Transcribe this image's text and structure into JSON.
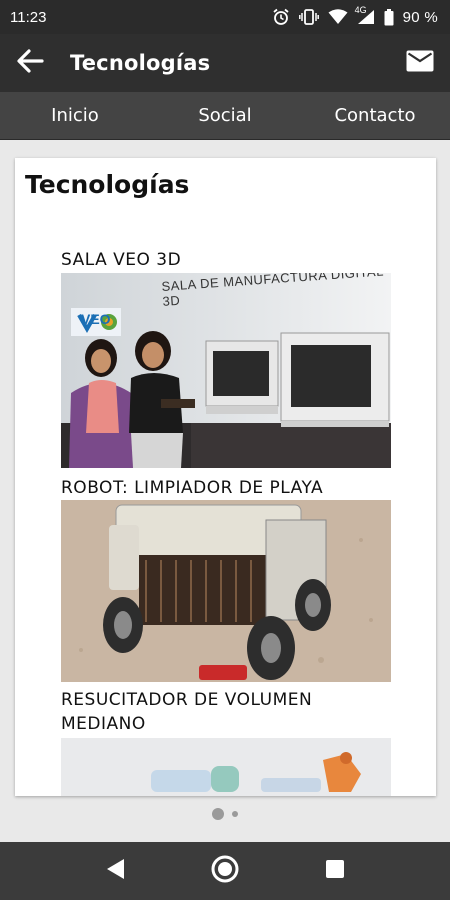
{
  "status_bar": {
    "time": "11:23",
    "network": "4G",
    "battery": "90 %",
    "icons": [
      "alarm-icon",
      "vibrate-icon",
      "wifi-icon",
      "signal-icon",
      "battery-icon"
    ]
  },
  "app_bar": {
    "title": "Tecnologías",
    "icons": [
      "back-arrow-icon",
      "mail-icon"
    ]
  },
  "tabs": [
    {
      "label": "Inicio"
    },
    {
      "label": "Social"
    },
    {
      "label": "Contacto"
    }
  ],
  "card": {
    "title": "Tecnologías",
    "items": [
      {
        "title": "SALA VEO 3D",
        "image_text": "SALA DE MANUFACTURA DIGITAL 3D",
        "logo": "VEO"
      },
      {
        "title": "ROBOT: LIMPIADOR DE PLAYA"
      },
      {
        "title": "RESUCITADOR DE VOLUMEN MEDIANO"
      }
    ]
  },
  "pager": {
    "count": 2,
    "active": 1
  },
  "nav_bar": {
    "icons": [
      "nav-back-icon",
      "nav-home-icon",
      "nav-recents-icon"
    ]
  },
  "colors": {
    "status_bar": "#2b2b2b",
    "app_bar": "#2f2f2f",
    "tab_bar": "#444444",
    "nav_bar": "#3b3b3b",
    "background": "#e9e9e9"
  }
}
